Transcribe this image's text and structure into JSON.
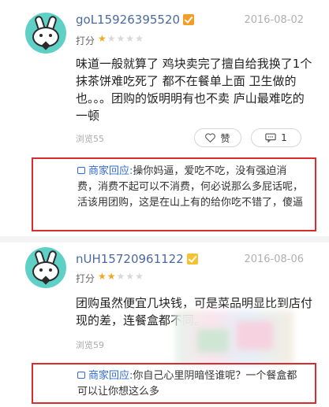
{
  "reviews": [
    {
      "username": "goL15926395520",
      "badge_color": "#f39c26",
      "date": "2016-08-02",
      "score_label": "打分",
      "rating": 1,
      "max_rating": 5,
      "content": "味道一般就算了 鸡块卖完了擅自给我换了1个抹茶饼难吃死了 都不在餐单上面 卫生做的也。。。团购的饭明明有也不卖 庐山最难吃的一顿",
      "views": "浏览55",
      "like_label": "赞",
      "comment_count": "1",
      "merchant_label": "商家回应:",
      "merchant_reply": "操你妈逼，爱吃不吃，没有强迫消费，消费不起可以不消费，何必说那么多屁话呢，活该用团购，这是在山上有的给你吃不错了，傻逼"
    },
    {
      "username": "nUH15720961122",
      "badge_color": "#f5c12e",
      "date": "2016-08-06",
      "score_label": "打分",
      "rating": 2,
      "max_rating": 5,
      "content": "团购虽然便宜几块钱，可是菜品明显比到店付现的差，连餐盒都不同。",
      "views": "浏览59",
      "merchant_label": "商家回应:",
      "merchant_reply": "你自己心里阴暗怪谁呢？一个餐盒都可以让你想这么多"
    }
  ],
  "colors": {
    "accent_border": "#d92d2d",
    "merchant_label": "#2f6bd3",
    "username": "#4b6aa0",
    "star_on": "#f3a623",
    "star_off": "#d8d8d8"
  }
}
